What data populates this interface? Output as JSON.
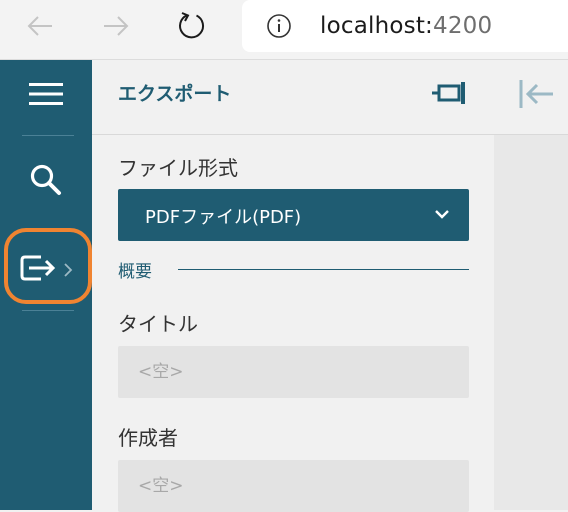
{
  "browser": {
    "url_host": "localhost:",
    "url_port": "4200",
    "icons": [
      "back-arrow-icon",
      "forward-arrow-icon",
      "refresh-icon",
      "info-icon"
    ]
  },
  "toolbar": {
    "items": [
      {
        "name": "menu",
        "icon": "hamburger-icon"
      },
      {
        "name": "search",
        "icon": "search-icon"
      },
      {
        "name": "export",
        "icon": "export-icon",
        "focused": true
      }
    ]
  },
  "panel": {
    "title": "エクスポート",
    "format_label": "ファイル形式",
    "format_value": "PDFファイル(PDF)",
    "section_summary": "概要",
    "title_label": "タイトル",
    "title_placeholder": "<空>",
    "author_label": "作成者",
    "author_placeholder": "<空>"
  },
  "colors": {
    "primary": "#1f5c72",
    "focus_ring": "#f08431",
    "input_bg": "#e3e3e3"
  }
}
